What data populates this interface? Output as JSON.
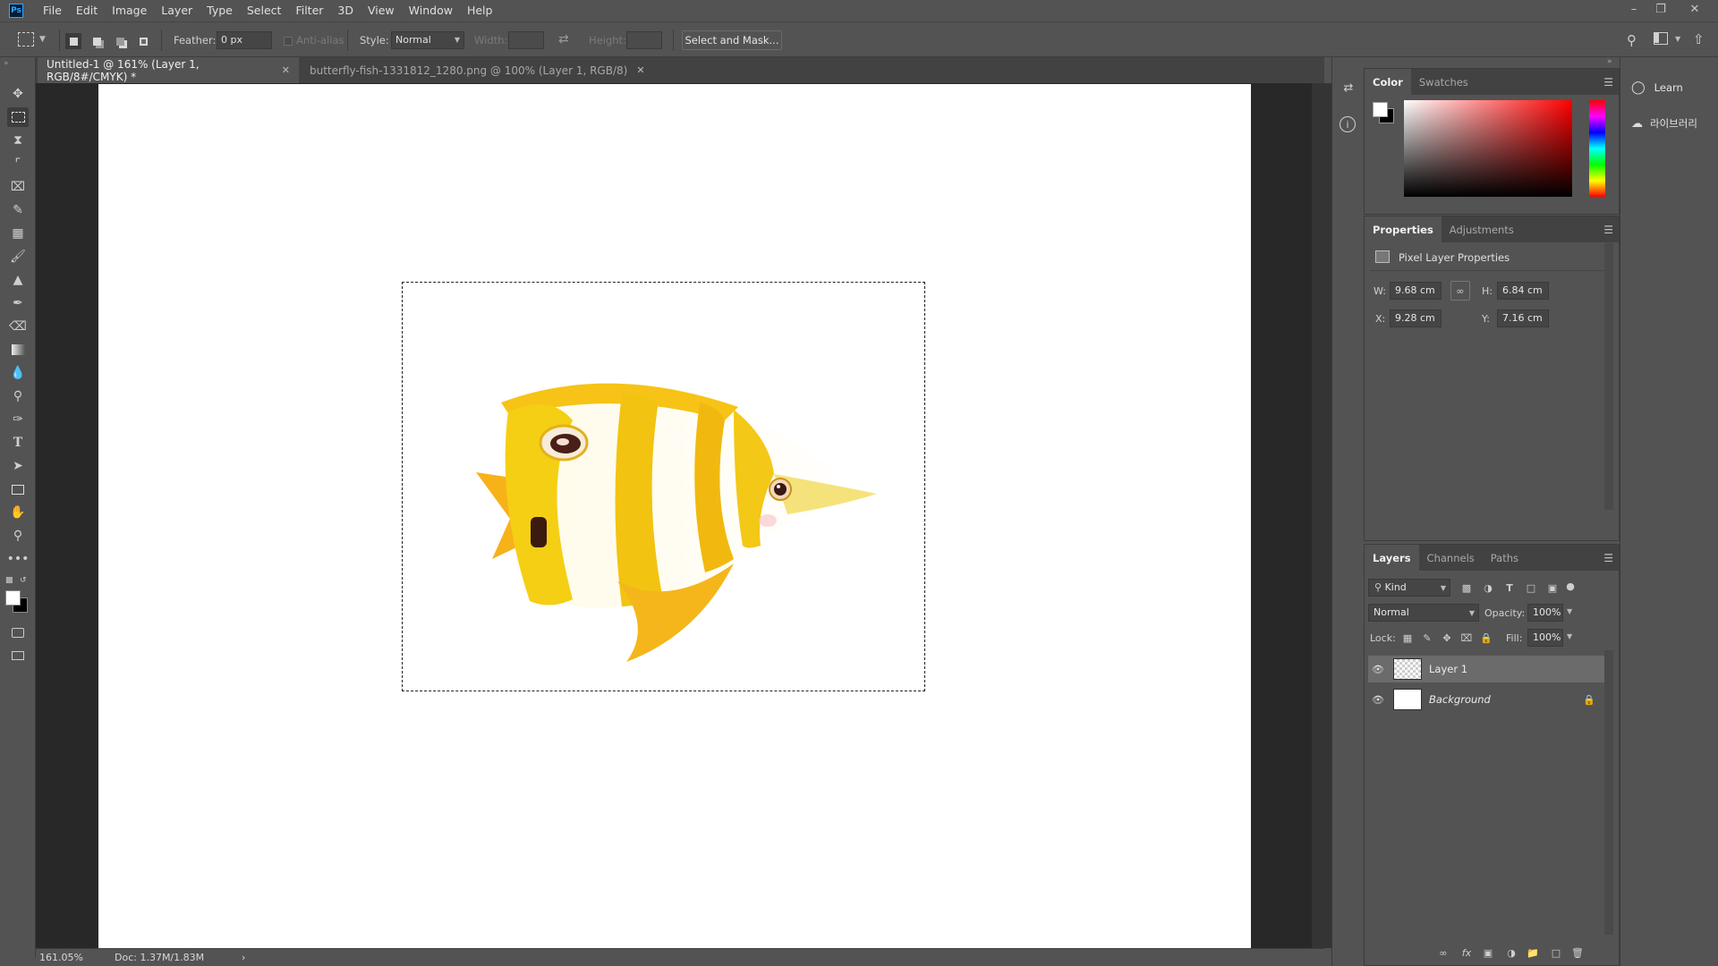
{
  "menu": [
    "File",
    "Edit",
    "Image",
    "Layer",
    "Type",
    "Select",
    "Filter",
    "3D",
    "View",
    "Window",
    "Help"
  ],
  "app": {
    "logo_text": "Ps"
  },
  "options": {
    "feather_label": "Feather:",
    "feather_value": "0 px",
    "antialias_label": "Anti-alias",
    "style_label": "Style:",
    "style_value": "Normal",
    "width_label": "Width:",
    "height_label": "Height:",
    "select_mask_label": "Select and Mask..."
  },
  "tabs": [
    {
      "label": "Untitled-1 @ 161% (Layer 1, RGB/8#/CMYK) *",
      "active": true
    },
    {
      "label": "butterfly-fish-1331812_1280.png @ 100% (Layer 1, RGB/8)",
      "active": false
    }
  ],
  "status": {
    "zoom": "161.05%",
    "doc": "Doc: 1.37M/1.83M",
    "arrow": "›"
  },
  "color_panel": {
    "tabs": [
      "Color",
      "Swatches"
    ]
  },
  "properties_panel": {
    "tabs": [
      "Properties",
      "Adjustments"
    ],
    "heading": "Pixel Layer Properties",
    "w_label": "W:",
    "w_value": "9.68 cm",
    "h_label": "H:",
    "h_value": "6.84 cm",
    "x_label": "X:",
    "x_value": "9.28 cm",
    "y_label": "Y:",
    "y_value": "7.16 cm"
  },
  "layers_panel": {
    "tabs": [
      "Layers",
      "Channels",
      "Paths"
    ],
    "kind_label": "Kind",
    "blend_mode": "Normal",
    "opacity_label": "Opacity:",
    "opacity_value": "100%",
    "lock_label": "Lock:",
    "fill_label": "Fill:",
    "fill_value": "100%",
    "layers": [
      {
        "name": "Layer 1",
        "selected": true,
        "locked": false
      },
      {
        "name": "Background",
        "selected": false,
        "locked": true
      }
    ]
  },
  "right_strip": {
    "learn_label": "Learn",
    "libraries_label": "라이브러리"
  },
  "colors": {
    "accent": "#31a8ff",
    "foreground": "#ffffff",
    "background": "#000000"
  }
}
